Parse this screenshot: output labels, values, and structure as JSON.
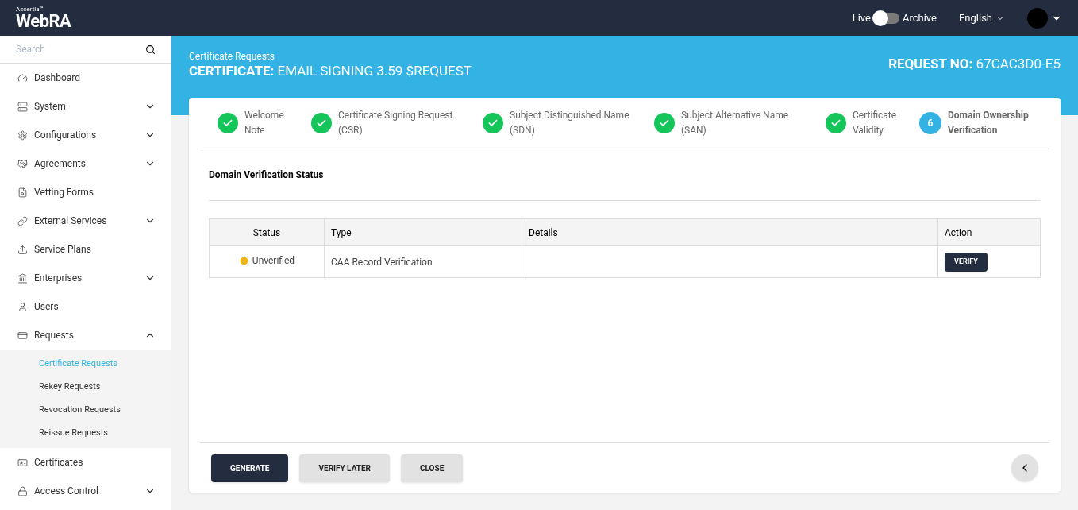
{
  "header": {
    "brand_small": "Ascertia™",
    "brand": "WebRA",
    "mode_toggle": {
      "left_label": "Live",
      "right_label": "Archive",
      "on": false
    },
    "language": "English"
  },
  "sidebar": {
    "search": {
      "placeholder": "Search"
    },
    "items": [
      {
        "label": "Dashboard"
      },
      {
        "label": "System",
        "expanded": false
      },
      {
        "label": "Configurations",
        "expanded": false
      },
      {
        "label": "Agreements",
        "expanded": false
      },
      {
        "label": "Vetting Forms"
      },
      {
        "label": "External Services",
        "expanded": false
      },
      {
        "label": "Service Plans"
      },
      {
        "label": "Enterprises",
        "expanded": false
      },
      {
        "label": "Users"
      },
      {
        "label": "Requests",
        "expanded": true,
        "children": [
          {
            "label": "Certificate Requests",
            "selected": true
          },
          {
            "label": "Rekey Requests",
            "selected": false
          },
          {
            "label": "Revocation Requests",
            "selected": false
          },
          {
            "label": "Reissue Requests",
            "selected": false
          }
        ]
      },
      {
        "label": "Certificates"
      },
      {
        "label": "Access Control",
        "expanded": false
      }
    ]
  },
  "page": {
    "breadcrumb": "Certificate Requests",
    "title_label": "CERTIFICATE:",
    "title_value": "EMAIL SIGNING 3.59 $REQUEST",
    "request_label": "REQUEST NO:",
    "request_value": "67CAC3D0-E5"
  },
  "steps": [
    {
      "label": "Welcome Note",
      "completed": true
    },
    {
      "label": "Certificate Signing Request (CSR)",
      "completed": true
    },
    {
      "label": "Subject Distinguished Name (SDN)",
      "completed": true
    },
    {
      "label": "Subject Alternative Name (SAN)",
      "completed": true
    },
    {
      "label": "Certificate Validity",
      "completed": true
    },
    {
      "label": "Domain Ownership Verification",
      "completed": false,
      "number": "6"
    }
  ],
  "section_title": "Domain Verification Status",
  "table": {
    "columns": [
      "Status",
      "Type",
      "Details",
      "Action"
    ],
    "rows": [
      {
        "status": "Unverified",
        "type": "CAA Record Verification",
        "details": "",
        "action": "VERIFY"
      }
    ]
  },
  "buttons": [
    {
      "label": "GENERATE",
      "kind": "primary"
    },
    {
      "label": "VERIFY LATER",
      "kind": "secondary"
    },
    {
      "label": "CLOSE",
      "kind": "secondary"
    }
  ]
}
